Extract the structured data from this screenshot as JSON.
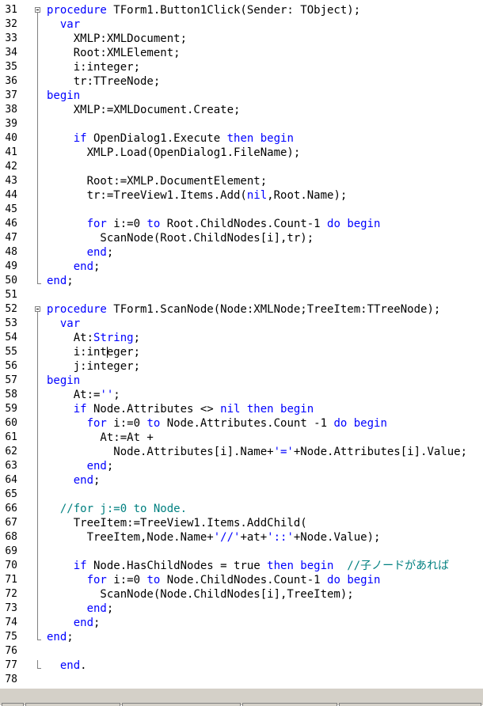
{
  "editor": {
    "language": "Delphi/Pascal",
    "colors": {
      "keyword": "#0000ff",
      "string": "#0000ff",
      "comment": "#008080",
      "text": "#000000"
    },
    "lines": [
      {
        "n": "31",
        "fold": "start",
        "segs": [
          [
            "kw",
            "procedure"
          ],
          [
            "t",
            " TForm1.Button1Click(Sender: TObject);"
          ]
        ]
      },
      {
        "n": "32",
        "segs": [
          [
            "t",
            "  "
          ],
          [
            "kw",
            "var"
          ]
        ]
      },
      {
        "n": "33",
        "segs": [
          [
            "t",
            "    XMLP:XMLDocument;"
          ]
        ]
      },
      {
        "n": "34",
        "segs": [
          [
            "t",
            "    Root:XMLElement;"
          ]
        ]
      },
      {
        "n": "35",
        "segs": [
          [
            "t",
            "    i:integer;"
          ]
        ]
      },
      {
        "n": "36",
        "segs": [
          [
            "t",
            "    tr:TTreeNode;"
          ]
        ]
      },
      {
        "n": "37",
        "segs": [
          [
            "kw",
            "begin"
          ]
        ]
      },
      {
        "n": "38",
        "segs": [
          [
            "t",
            "    XMLP:=XMLDocument.Create;"
          ]
        ]
      },
      {
        "n": "39",
        "segs": []
      },
      {
        "n": "40",
        "segs": [
          [
            "t",
            "    "
          ],
          [
            "kw",
            "if"
          ],
          [
            "t",
            " OpenDialog1.Execute "
          ],
          [
            "kw",
            "then begin"
          ]
        ]
      },
      {
        "n": "41",
        "segs": [
          [
            "t",
            "      XMLP.Load(OpenDialog1.FileName);"
          ]
        ]
      },
      {
        "n": "42",
        "segs": []
      },
      {
        "n": "43",
        "segs": [
          [
            "t",
            "      Root:=XMLP.DocumentElement;"
          ]
        ]
      },
      {
        "n": "44",
        "segs": [
          [
            "t",
            "      tr:=TreeView1.Items.Add("
          ],
          [
            "kw",
            "nil"
          ],
          [
            "t",
            ",Root.Name);"
          ]
        ]
      },
      {
        "n": "45",
        "segs": []
      },
      {
        "n": "46",
        "segs": [
          [
            "t",
            "      "
          ],
          [
            "kw",
            "for"
          ],
          [
            "t",
            " i:=0 "
          ],
          [
            "kw",
            "to"
          ],
          [
            "t",
            " Root.ChildNodes.Count-1 "
          ],
          [
            "kw",
            "do begin"
          ]
        ]
      },
      {
        "n": "47",
        "segs": [
          [
            "t",
            "        ScanNode(Root.ChildNodes[i],tr);"
          ]
        ]
      },
      {
        "n": "48",
        "segs": [
          [
            "t",
            "      "
          ],
          [
            "kw",
            "end"
          ],
          [
            "t",
            ";"
          ]
        ]
      },
      {
        "n": "49",
        "segs": [
          [
            "t",
            "    "
          ],
          [
            "kw",
            "end"
          ],
          [
            "t",
            ";"
          ]
        ]
      },
      {
        "n": "50",
        "fold": "end",
        "segs": [
          [
            "kw",
            "end"
          ],
          [
            "t",
            ";"
          ]
        ]
      },
      {
        "n": "51",
        "segs": []
      },
      {
        "n": "52",
        "fold": "start",
        "segs": [
          [
            "kw",
            "procedure"
          ],
          [
            "t",
            " TForm1.ScanNode(Node:XMLNode;TreeItem:TTreeNode);"
          ]
        ]
      },
      {
        "n": "53",
        "segs": [
          [
            "t",
            "  "
          ],
          [
            "kw",
            "var"
          ]
        ]
      },
      {
        "n": "54",
        "segs": [
          [
            "t",
            "    At:"
          ],
          [
            "kw",
            "String"
          ],
          [
            "t",
            ";"
          ]
        ]
      },
      {
        "n": "55",
        "segs": [
          [
            "t",
            "    i:integer;"
          ]
        ]
      },
      {
        "n": "56",
        "segs": [
          [
            "t",
            "    j:integer;"
          ]
        ]
      },
      {
        "n": "57",
        "segs": [
          [
            "kw",
            "begin"
          ]
        ]
      },
      {
        "n": "58",
        "segs": [
          [
            "t",
            "    At:="
          ],
          [
            "str",
            "''"
          ],
          [
            "t",
            ";"
          ]
        ]
      },
      {
        "n": "59",
        "segs": [
          [
            "t",
            "    "
          ],
          [
            "kw",
            "if"
          ],
          [
            "t",
            " Node.Attributes <> "
          ],
          [
            "kw",
            "nil then begin"
          ]
        ]
      },
      {
        "n": "60",
        "segs": [
          [
            "t",
            "      "
          ],
          [
            "kw",
            "for"
          ],
          [
            "t",
            " i:=0 "
          ],
          [
            "kw",
            "to"
          ],
          [
            "t",
            " Node.Attributes.Count -1 "
          ],
          [
            "kw",
            "do begin"
          ]
        ]
      },
      {
        "n": "61",
        "segs": [
          [
            "t",
            "        At:=At +"
          ]
        ]
      },
      {
        "n": "62",
        "segs": [
          [
            "t",
            "          Node.Attributes[i].Name+"
          ],
          [
            "str",
            "'='"
          ],
          [
            "t",
            "+Node.Attributes[i].Value;"
          ]
        ]
      },
      {
        "n": "63",
        "segs": [
          [
            "t",
            "      "
          ],
          [
            "kw",
            "end"
          ],
          [
            "t",
            ";"
          ]
        ]
      },
      {
        "n": "64",
        "segs": [
          [
            "t",
            "    "
          ],
          [
            "kw",
            "end"
          ],
          [
            "t",
            ";"
          ]
        ]
      },
      {
        "n": "65",
        "segs": []
      },
      {
        "n": "66",
        "segs": [
          [
            "cmt",
            "  //for j:=0 to Node."
          ]
        ]
      },
      {
        "n": "67",
        "segs": [
          [
            "t",
            "    TreeItem:=TreeView1.Items.AddChild("
          ]
        ]
      },
      {
        "n": "68",
        "segs": [
          [
            "t",
            "      TreeItem,Node.Name+"
          ],
          [
            "str",
            "'//'"
          ],
          [
            "t",
            "+at+"
          ],
          [
            "str",
            "'::'"
          ],
          [
            "t",
            "+Node.Value);"
          ]
        ]
      },
      {
        "n": "69",
        "segs": []
      },
      {
        "n": "70",
        "segs": [
          [
            "t",
            "    "
          ],
          [
            "kw",
            "if"
          ],
          [
            "t",
            " Node.HasChildNodes = true "
          ],
          [
            "kw",
            "then begin"
          ],
          [
            "cmt",
            "  //子ノードがあれば"
          ]
        ]
      },
      {
        "n": "71",
        "segs": [
          [
            "t",
            "      "
          ],
          [
            "kw",
            "for"
          ],
          [
            "t",
            " i:=0 "
          ],
          [
            "kw",
            "to"
          ],
          [
            "t",
            " Node.ChildNodes.Count-1 "
          ],
          [
            "kw",
            "do begin"
          ]
        ]
      },
      {
        "n": "72",
        "segs": [
          [
            "t",
            "        ScanNode(Node.ChildNodes[i],TreeItem);"
          ]
        ]
      },
      {
        "n": "73",
        "segs": [
          [
            "t",
            "      "
          ],
          [
            "kw",
            "end"
          ],
          [
            "t",
            ";"
          ]
        ]
      },
      {
        "n": "74",
        "segs": [
          [
            "t",
            "    "
          ],
          [
            "kw",
            "end"
          ],
          [
            "t",
            ";"
          ]
        ]
      },
      {
        "n": "75",
        "fold": "end",
        "segs": [
          [
            "kw",
            "end"
          ],
          [
            "t",
            ";"
          ]
        ]
      },
      {
        "n": "76",
        "segs": []
      },
      {
        "n": "77",
        "fold": "end",
        "segs": [
          [
            "t",
            "  "
          ],
          [
            "kw",
            "end"
          ],
          [
            "t",
            "."
          ]
        ]
      },
      {
        "n": "78",
        "segs": []
      }
    ]
  }
}
